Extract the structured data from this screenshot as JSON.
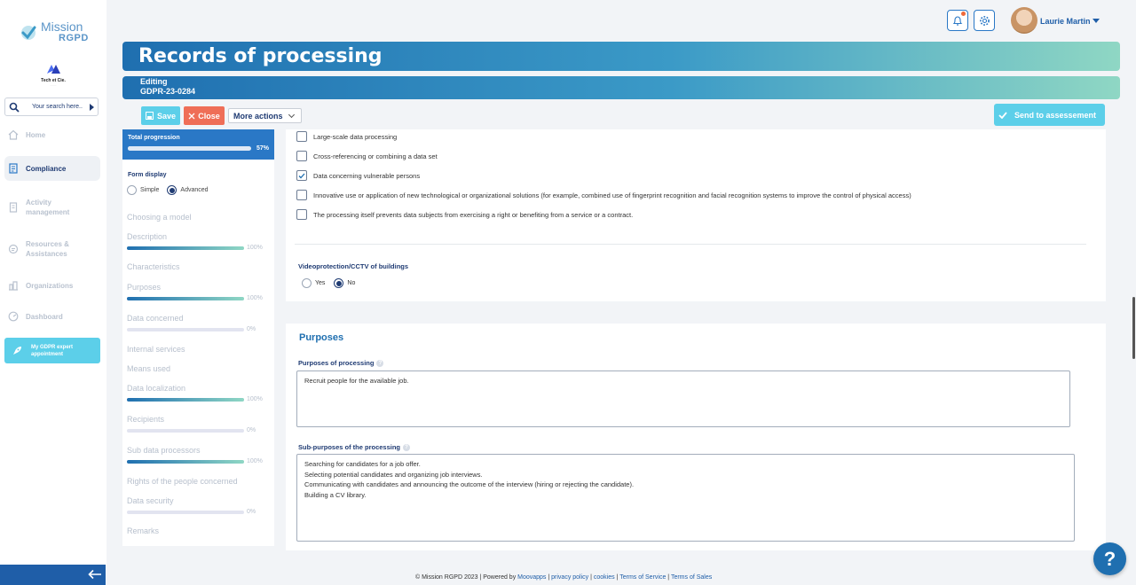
{
  "app": {
    "logo_line1": "Mission",
    "logo_line2": "RGPD",
    "company_name": "Tech et Cie."
  },
  "sidebar": {
    "search_placeholder": "Your search here..",
    "items": [
      {
        "label": "Home",
        "icon": "home-icon"
      },
      {
        "label": "Compliance",
        "icon": "compliance-icon"
      },
      {
        "label": "Activity management",
        "icon": "activity-icon"
      },
      {
        "label": "Resources & Assistances",
        "icon": "resources-icon"
      },
      {
        "label": "Organizations",
        "icon": "organizations-icon"
      },
      {
        "label": "Dashboard",
        "icon": "dashboard-icon"
      }
    ],
    "expert_button": "My GDPR expert appointment"
  },
  "header": {
    "user_name": "Laurie Martin"
  },
  "page": {
    "title": "Records of processing",
    "edit_status": "Editing",
    "record_id": "GDPR-23-0284"
  },
  "toolbar": {
    "save": "Save",
    "close": "Close",
    "more_actions": "More actions",
    "send": "Send to assessement"
  },
  "progress": {
    "total_label": "Total progression",
    "total_percent": "57%",
    "total_value": 0.57,
    "form_display_label": "Form display",
    "mode_simple": "Simple",
    "mode_advanced": "Advanced",
    "sections": [
      {
        "label": "Choosing a model"
      },
      {
        "label": "Description",
        "percent": "100%",
        "value": 1.0
      },
      {
        "label": "Characteristics"
      },
      {
        "label": "Purposes",
        "percent": "100%",
        "value": 1.0
      },
      {
        "label": "Data concerned",
        "percent": "0%",
        "value": 0
      },
      {
        "label": "Internal services"
      },
      {
        "label": "Means used"
      },
      {
        "label": "Data localization",
        "percent": "100%",
        "value": 1.0
      },
      {
        "label": "Recipients",
        "percent": "0%",
        "value": 0
      },
      {
        "label": "Sub data processors",
        "percent": "100%",
        "value": 1.0
      },
      {
        "label": "Rights of the people concerned"
      },
      {
        "label": "Data security",
        "percent": "0%",
        "value": 0
      },
      {
        "label": "Remarks"
      }
    ]
  },
  "criteria": {
    "items": [
      {
        "label": "Large-scale data processing",
        "checked": false
      },
      {
        "label": "Cross-referencing or combining a data set",
        "checked": false
      },
      {
        "label": "Data concerning vulnerable persons",
        "checked": true
      },
      {
        "label": "Innovative use or application of new technological or organizational solutions (for example, combined use of fingerprint recognition and facial recognition systems to improve the control of physical access)",
        "checked": false
      },
      {
        "label": "The processing itself prevents data subjects from exercising a right or benefiting from a service or a contract.",
        "checked": false
      }
    ],
    "video_label": "Videoprotection/CCTV of buildings",
    "video_yes": "Yes",
    "video_no": "No"
  },
  "purposes": {
    "heading": "Purposes",
    "purpose_label": "Purposes of processing",
    "purpose_value": "Recruit people for the available job.",
    "sub_label": "Sub-purposes of the processing",
    "sub_lines": [
      "Searching for candidates for a job offer.",
      "Selecting potential candidates and organizing job interviews.",
      "Communicating with candidates and announcing the outcome of the interview (hiring or rejecting the candidate).",
      "Building a CV library."
    ]
  },
  "footer": {
    "copyright": "© Mission RGPD 2023 | Powered by ",
    "moovapps": "Moovapps",
    "privacy": "privacy policy",
    "cookies": "cookies",
    "tos": "Terms of Service",
    "sales": "Terms of Sales",
    "sep": " | "
  },
  "help_fab": "?",
  "colors": {
    "primary": "#1f6fb0",
    "accent": "#5ccfe9",
    "danger": "#ef6e57",
    "navy": "#1f3b73"
  }
}
